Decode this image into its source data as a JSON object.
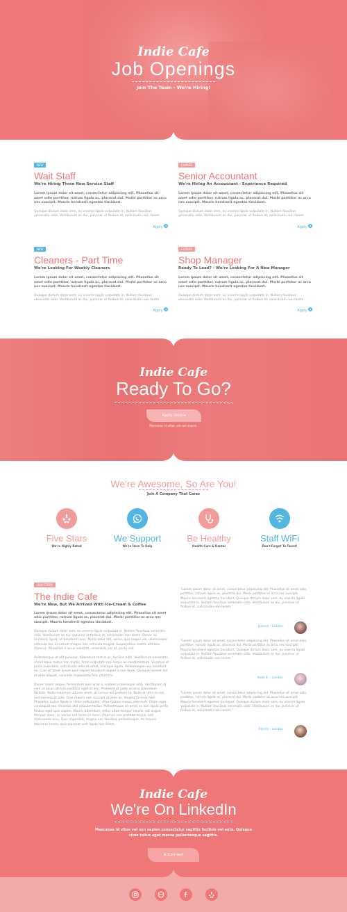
{
  "hero": {
    "brand": "Indie Cafe",
    "title": "Job Openings",
    "subtitle": "Join The Team - We're Hiring!"
  },
  "jobs": [
    {
      "tag": "NEW",
      "title": "Wait Staff",
      "subtitle": "We're Hiring Three New Service Staff",
      "bold_text": "Lorem ipsum dolor sit amet, consectetur adipiscing elit. Phasellus sit amet odio porttitor, rutrum ligula ac, placerat dui. Morbi porttitor ac arcu nec suscipit. Mauris hendrerit egestas tincidunt.",
      "text": "Quisque dictum dolor sem, eu viverra ligula vulputate in. Nullam faucibus venenatis odio. Vestibulum ac dui, pulvinar ut finibus et, sollicitudin non lorem.",
      "apply": "Apply"
    },
    {
      "tag": "CLOSED",
      "title": "Senior Accountant",
      "subtitle": "We're Hiring An Accountant - Experience Required",
      "bold_text": "Lorem ipsum dolor sit amet, consectetur adipiscing elit. Phasellus sit amet odio porttitor, rutrum ligula ac, placerat dui. Morbi porttitor ac arcu nec suscipit. Mauris hendrerit egestas tincidunt.",
      "text": "Quisque dictum dolor sem, eu viverra ligula vulputate in. Nullam faucibus venenatis odio. Vestibulum ac dui, pulvinar ut finibus et, sollicitudin non lorem.",
      "apply": "Apply"
    },
    {
      "tag": "NEW",
      "title": "Cleaners - Part Time",
      "subtitle": "We're Looking For Weekly Cleaners",
      "bold_text": "Lorem ipsum dolor sit amet, consectetur adipiscing elit. Phasellus sit amet odio porttitor, rutrum ligula ac, placerat dui. Morbi porttitor ac arcu nec suscipit. Mauris hendrerit egestas tincidunt.",
      "text": "Quisque dictum dolor sem, eu viverra ligula vulputate in. Nullam faucibus venenatis odio. Vestibulum ac dui, pulvinar ut finibus et, sollicitudin non lorem.",
      "apply": "Apply"
    },
    {
      "tag": "CLOSED",
      "title": "Shop Manager",
      "subtitle": "Ready To Lead? - We're Looking For A New Manager",
      "bold_text": "Lorem ipsum dolor sit amet, consectetur adipiscing elit. Phasellus sit amet odio porttitor, rutrum ligula ac, placerat dui. Morbi porttitor ac arcu nec suscipit. Mauris hendrerit egestas tincidunt.",
      "text": "Quisque dictum dolor sem, eu viverra ligula vulputate in. Nullam faucibus venenatis odio. Vestibulum ac dui, pulvinar ut finibus et, sollicitudin non lorem.",
      "apply": "Apply"
    }
  ],
  "ready": {
    "brand": "Indie Cafe",
    "title": "Ready To Go?",
    "button": "Apply Online",
    "note": "Maecenas id vitae, vel non sapien."
  },
  "awesome": {
    "title": "We're Awesome, So Are You!",
    "subtitle": "Join A Company That Cares",
    "features": [
      {
        "icon": "yelp-icon",
        "title": "Five Stars",
        "sub": "We're Highly Rated",
        "color": "pink"
      },
      {
        "icon": "whatsapp-icon",
        "title": "We Support",
        "sub": "We're Here To Help",
        "color": "blue"
      },
      {
        "icon": "stethoscope-icon",
        "title": "Be Healthy",
        "sub": "Health Care & Dental",
        "color": "pink"
      },
      {
        "icon": "wifi-icon",
        "title": "Staff WiFi",
        "sub": "Don't Forget To Tweet!",
        "color": "blue"
      }
    ]
  },
  "story": {
    "tag": "OUR STORY",
    "title": "The Indie Cafe",
    "subtitle": "We're New, But We Arrived With Ice-Cream & Coffee",
    "bold_text": "Lorem ipsum dolor sit amet, consectetur adipiscing elit. Phasellus sit amet odio porttitor, rutrum ligula ac, placerat dui. Morbi porttitor ac arcu nec suscipit. Mauris hendrerit egestas tincidunt.",
    "p1": "Quisque dictum dolor sem, eu viverra ligula vulputate in. Nullam faucibus venenatis odio. Vestibulum ac dui, pulvinar ut finibus et, sollicitudin non lorem. Donec ac tincidunt ligula, ut tincidunt risus. Morbi dolor elit, varius quis neque vel, ullamcorper vehicula leo. In rutrum magna non vehicula feugiat. Suspendisse mattis ultricies rhoncus. Phasellus a lacus volutpat, venenatis nisi at, porta sed.",
    "p2": "Pellentesque et elit pulvinar, bibendum metus ac, facilisis nibh. Vestibulum venenatis scelerisque metus non mollis. Proin vulputate non turpis ac condimentum. Vivamus et porta vulputate, sollicitudin odio sit amet, tristique ligula. Pellentesque nec tincidunt ex. Cras sit amet ipsum quis sapien tincidunt aliquet a non diam. Quisque laoreet dui et ante aliquet, convallis malesuada felis pharetra.",
    "p3": "Donec lorem neque, fermentum quis urna a, sodales scelerisque nibh. Vestibulum id sem ut lacus ultrices porttitor eget et orci. Praesent ut justo ac arcu bibendum facilisis. Nulla maximus ultrices enim, at cursus est pretium ut. Nulla et ultrices est, sed consequat odio. Duis mauris nisl, suscipit ut ante ac, feugiat facilisis nibh. Phasellus luctus ligula in tellus sollicitudin, vitae finibus massa interdum. Etiam eget consequat dui. Vivamus sed aliquam lectus. Pellentesque sit amet ex non ligula porta finibus eget quis sapien. Mauris bibendum, tellus vitae tempus iaculis, est augue tempus dolor, ac varius sed lorem in nunc. Vivamus non porttitor turpis, sed malesuada arcu. Duis imperdiet, magna nec faucibus pellentesque, mi mauris maximus lorem, quis placerat velit ligula hac lorem."
  },
  "testimonials": [
    {
      "text": "\"Lorem ipsum dolor sit amet, consectetur adipiscing elit. Phasellus sit amet odio porttitor, rutrum ligula ac, placerat dui. Morbi porttitor ac arcu nec suscipit. Mauris hendrerit egestas tincidunt. Quisque dictum dolor sem, eu viverra ligula vulputate in. Nullam faucibus venenatis odio. Vestibulum ac dui, pulvinar ut finibus et, sollicitudin non lorem.\"",
      "who": "Joanna - London"
    },
    {
      "text": "\"Lorem ipsum dolor sit amet, consectetur adipiscing elit. Phasellus sit amet odio porttitor, rutrum ligula ac, placerat dui. Morbi porttitor ac arcu nec suscipit. Mauris hendrerit egestas tincidunt. Quisque dictum dolor sem, eu viverra ligula vulputate in. Nullam faucibus venenatis odio. Vestibulum ac dui, pulvinar ut finibus et, sollicitudin non lorem.\"",
      "who": "Kate A. - London"
    },
    {
      "text": "\"Lorem ipsum dolor sit amet, consectetur adipiscing elit. Phasellus sit amet odio porttitor, rutrum ligula ac, placerat dui. Morbi porttitor ac arcu nec suscipit. Mauris hendrerit egestas tincidunt. Quisque dictum dolor sem, eu viverra ligula vulputate in. Nullam faucibus venenatis odio. Vestibulum ac dui, pulvinar ut finibus et, sollicitudin non lorem.\"",
      "who": "Alyssa - London"
    }
  ],
  "linkedin": {
    "brand": "Indie Cafe",
    "title": "We're On LinkedIn",
    "text": "Maecenas id vitae  vel non sapien consectetur sagittis facilisis vel ante. Quisque vitae tellus eget massa pellentesque sagittis.",
    "button": "Connect"
  },
  "footer": {
    "icons": [
      "instagram-icon",
      "tripadvisor-icon",
      "facebook-icon",
      "yelp-icon"
    ]
  },
  "colors": {
    "pink": "#ef7777",
    "light_pink": "#f29b9b",
    "blue": "#52b6e0"
  }
}
